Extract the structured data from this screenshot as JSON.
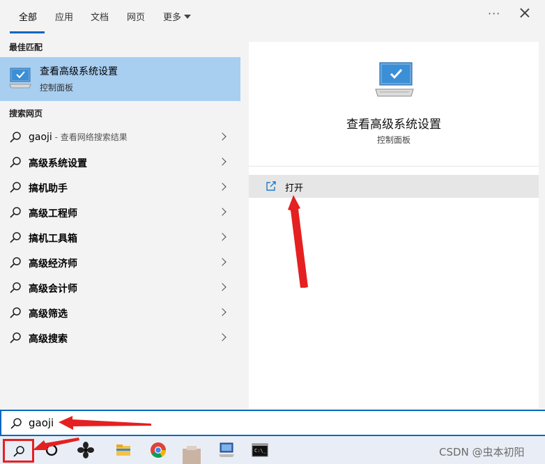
{
  "tabs": [
    {
      "label": "全部",
      "active": true
    },
    {
      "label": "应用"
    },
    {
      "label": "文档"
    },
    {
      "label": "网页"
    },
    {
      "label": "更多"
    }
  ],
  "header": {
    "more_menu_icon": "ellipsis-icon",
    "close_icon": "close-icon"
  },
  "left": {
    "best_match_heading": "最佳匹配",
    "best_match": {
      "title": "查看高级系统设置",
      "subtitle": "控制面板",
      "icon": "computer-monitor-icon"
    },
    "web_heading": "搜索网页",
    "web_results": [
      {
        "label": "gaoji",
        "hint": " - 查看网络搜索结果"
      },
      {
        "label": "高级系统设置"
      },
      {
        "label": "搞机助手"
      },
      {
        "label": "高级工程师"
      },
      {
        "label": "搞机工具箱"
      },
      {
        "label": "高级经济师"
      },
      {
        "label": "高级会计师"
      },
      {
        "label": "高级筛选"
      },
      {
        "label": "高级搜索"
      }
    ]
  },
  "right": {
    "title": "查看高级系统设置",
    "subtitle": "控制面板",
    "actions": [
      {
        "label": "打开",
        "icon": "open-external-icon"
      }
    ]
  },
  "search": {
    "value": "gaoji"
  },
  "taskbar": {
    "items": [
      "search-icon",
      "cortana-circle-icon",
      "fan-app-icon",
      "file-explorer-icon",
      "chrome-icon",
      "blurred-app-icon",
      "computer-app-icon",
      "terminal-icon"
    ],
    "watermark": "CSDN @虫本初阳"
  },
  "colors": {
    "accent": "#0067c0",
    "selection": "#a8cef0",
    "annotation": "#e52020"
  }
}
